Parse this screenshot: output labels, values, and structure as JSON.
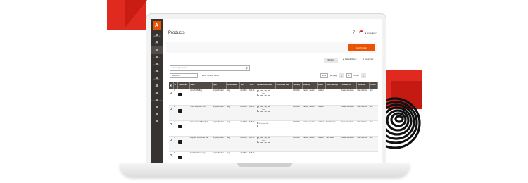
{
  "page": {
    "title": "Products",
    "user": "Amedium",
    "add_product": "Add Product",
    "filters": "Filters",
    "view": "Default View",
    "columns": "Columns",
    "search_placeholder": "Search by keyword",
    "actions": "Actions",
    "records_found": "2310 records found",
    "per_page": "20",
    "page_num": "1",
    "of_pages": "of 116"
  },
  "sidebar": {
    "logo": "A",
    "items": [
      "DASHBOARD",
      "SALES",
      "CATALOG",
      "CUSTOMERS",
      "MARKETING",
      "CONTENT",
      "REPORTS",
      "STORES",
      "SYSTEM",
      "FIND PARTNERS & EXTENSIONS",
      "",
      "",
      ""
    ]
  },
  "columns": [
    "ID",
    "Thumbnail",
    "Name",
    "Type",
    "Attribute Set",
    "SKU",
    "Price",
    "Upload Attachment",
    "Attachment Link",
    "Quantity",
    "Visibility",
    "Status",
    "Latest Savings",
    "Available By",
    "Websites",
    "Action"
  ],
  "rows": [
    {
      "id": "1",
      "name": "Joust Duffle Bag",
      "type": "Simple Product",
      "set": "Bag",
      "sku": "24-MB01",
      "price": "$34.00",
      "upload": "Click or Drag Files Here",
      "link": "",
      "qty": "100.0000",
      "visibility": "Catalog, Search",
      "status": "Enabled",
      "savings": "",
      "available": "Default Exclusive",
      "website": "Main Website",
      "action": "Edit"
    },
    {
      "id": "2",
      "name": "Strive Shoulder Pack",
      "type": "Simple Product",
      "set": "Bag",
      "sku": "24-MB04",
      "price": "$32.00",
      "upload": "Click or Drag Files Here",
      "link": "",
      "qty": "100.0000",
      "visibility": "Catalog, Search",
      "status": "Enabled",
      "savings": "",
      "available": "Default Exclusive",
      "website": "Main Website",
      "action": "Edit"
    },
    {
      "id": "3",
      "name": "Crown Summit Backpack",
      "type": "Simple Product",
      "set": "Bag",
      "sku": "24-MB03",
      "price": "$38.00",
      "upload": "Click or Drag Files Here",
      "link": "",
      "qty": "100.0000",
      "visibility": "Catalog, Search",
      "status": "Enabled",
      "savings": "Best Product",
      "available": "Default Exclusive",
      "website": "Main Website",
      "action": "Edit"
    },
    {
      "id": "4",
      "name": "Wayfarer Messenger Bag",
      "type": "Simple Product",
      "set": "Bag",
      "sku": "24-MB05",
      "price": "$45.00",
      "upload": "Click or Drag Files Here",
      "link": "",
      "qty": "100.0000",
      "visibility": "Catalog, Search",
      "status": "Enabled",
      "savings": "New Seller",
      "available": "Default Exclusive",
      "website": "Main Website",
      "action": "Edit"
    },
    {
      "id": "5",
      "name": "Rival Field Messenger",
      "type": "Simple Product",
      "set": "Bag",
      "sku": "24-MB06",
      "price": "$45.00",
      "upload": "",
      "link": "",
      "qty": "",
      "visibility": "",
      "status": "",
      "savings": "",
      "available": "",
      "website": "",
      "action": ""
    }
  ],
  "colors": {
    "accent": "#eb5202",
    "sidebar": "#373330",
    "table_header": "#514943",
    "decor_red": "#e02a1f"
  }
}
